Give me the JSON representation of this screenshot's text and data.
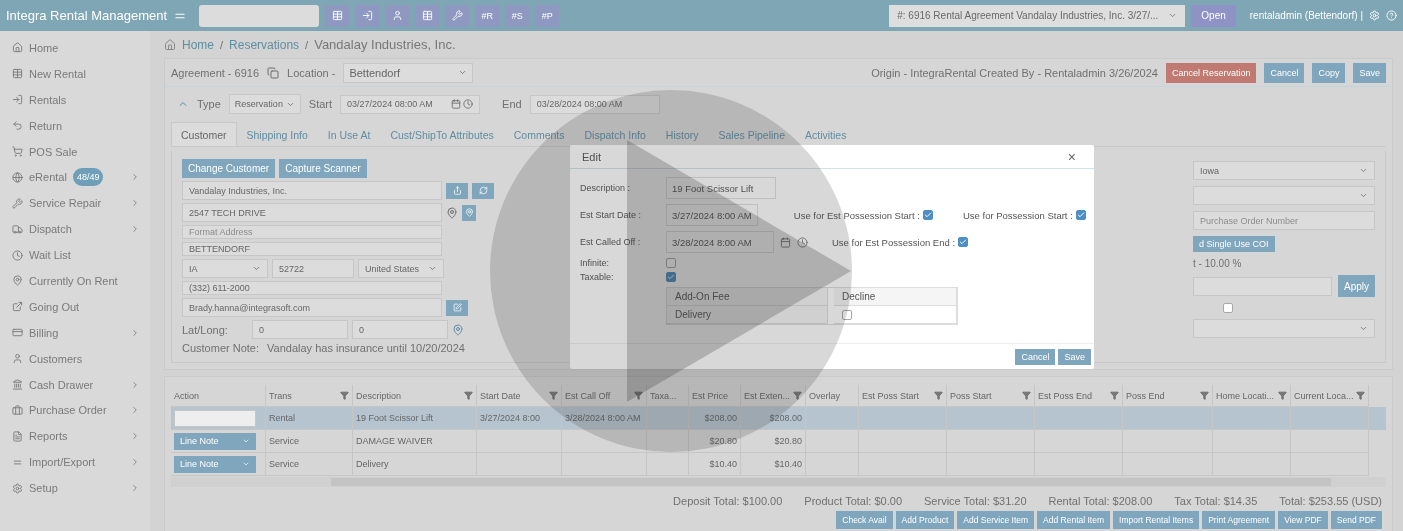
{
  "top_bar": {
    "brand": "Integra Rental Management",
    "shortcuts": [
      "#R",
      "#S",
      "#P"
    ],
    "agreement_select": "#: 6916 Rental Agreement Vandalay Industries, Inc. 3/27/...",
    "open_button": "Open",
    "user": "rentaladmin (Bettendorf) |"
  },
  "sidebar": {
    "items": [
      {
        "label": "Home",
        "expandable": false
      },
      {
        "label": "New Rental",
        "expandable": false
      },
      {
        "label": "Rentals",
        "expandable": false
      },
      {
        "label": "Return",
        "expandable": false
      },
      {
        "label": "POS Sale",
        "expandable": false
      },
      {
        "label": "eRental",
        "badge": "48/49",
        "expandable": true
      },
      {
        "label": "Service Repair",
        "expandable": true
      },
      {
        "label": "Dispatch",
        "expandable": true
      },
      {
        "label": "Wait List",
        "expandable": false
      },
      {
        "label": "Currently On Rent",
        "expandable": false
      },
      {
        "label": "Going Out",
        "expandable": false
      },
      {
        "label": "Billing",
        "expandable": true
      },
      {
        "label": "Customers",
        "expandable": false
      },
      {
        "label": "Cash Drawer",
        "expandable": true
      },
      {
        "label": "Purchase Order",
        "expandable": true
      },
      {
        "label": "Reports",
        "expandable": true
      },
      {
        "label": "Import/Export",
        "expandable": true
      },
      {
        "label": "Setup",
        "expandable": true
      }
    ]
  },
  "breadcrumb": [
    {
      "label": "Home",
      "kind": "link"
    },
    {
      "label": "/",
      "kind": "separator"
    },
    {
      "label": "Reservations",
      "kind": "link"
    },
    {
      "label": "/",
      "kind": "separator"
    },
    {
      "label": "Vandalay Industries, Inc.",
      "kind": "current"
    }
  ],
  "agreement": {
    "title": "Agreement - 6916",
    "location_label": "Location -",
    "location": "Bettendorf",
    "origin": "Origin - IntegraRental Created By - Rentaladmin 3/26/2024",
    "buttons": [
      {
        "label": "Cancel Reservation",
        "kind": "danger"
      },
      {
        "label": "Cancel",
        "kind": "primary"
      },
      {
        "label": "Copy",
        "kind": "primary"
      },
      {
        "label": "Save",
        "kind": "primary"
      }
    ]
  },
  "dates": {
    "type_label": "Type",
    "type": "Reservation",
    "start_label": "Start",
    "start": "03/27/2024 08:00 AM",
    "end_label": "End",
    "end": "03/28/2024 08:00 AM"
  },
  "tabs": [
    {
      "label": "Customer",
      "selected": true
    },
    {
      "label": "Shipping Info",
      "selected": false
    },
    {
      "label": "In Use At",
      "selected": false
    },
    {
      "label": "Cust/ShipTo Attributes",
      "selected": false
    },
    {
      "label": "Comments",
      "selected": false
    },
    {
      "label": "Dispatch Info",
      "selected": false
    },
    {
      "label": "History",
      "selected": false
    },
    {
      "label": "Sales Pipeline",
      "selected": false
    },
    {
      "label": "Activities",
      "selected": false
    }
  ],
  "customer": {
    "buttons": [
      "Change Customer",
      "Capture Scanner"
    ],
    "name": "Vandalay Industries, Inc.",
    "address": "2547 TECH DRIVE",
    "address2_placeholder": "Format Address",
    "city": "BETTENDORF",
    "state": "IA",
    "zip": "52722",
    "country": "United States",
    "phone": "(332) 611-2000",
    "email": "Brady.hanna@integrasoft.com",
    "latlong_label": "Lat/Long:",
    "lat": "0",
    "long": "0",
    "note_label": "Customer Note:",
    "note": "Vandalay has insurance until 10/20/2024"
  },
  "side_panel": {
    "state": "Iowa",
    "po_placeholder": "Purchase Order Number",
    "coi_button": "d Single Use COI",
    "discount": "t - 10.00 %",
    "apply_button": "Apply",
    "checked": false
  },
  "modal": {
    "title": "Edit",
    "close": "×",
    "description_label": "Description :",
    "description": "19 Foot Scissor Lift",
    "rows": [
      {
        "label": "Est Start Date :",
        "value": "3/27/2024 8:00 AM",
        "checks": [
          {
            "label": "Use for Est Possession Start :",
            "checked": true
          },
          {
            "label": "Use for Possession Start :",
            "checked": true
          }
        ]
      },
      {
        "label": "Est Called Off :",
        "value": "3/28/2024 8:00 AM",
        "checks": [
          {
            "label": "Use for Est Possession End :",
            "checked": true
          }
        ]
      }
    ],
    "flags": [
      {
        "label": "Infinite:",
        "checked": false
      },
      {
        "label": "Taxable:",
        "checked": true
      }
    ],
    "addon_table": {
      "columns": [
        "Add-On Fee",
        "Decline"
      ],
      "rows": [
        {
          "fee": "Delivery",
          "declined": false
        }
      ]
    },
    "buttons": [
      "Cancel",
      "Save"
    ]
  },
  "grid": {
    "columns": [
      {
        "label": "Action",
        "filter": false
      },
      {
        "label": "Trans",
        "filter": true
      },
      {
        "label": "Description",
        "filter": true
      },
      {
        "label": "Start Date",
        "filter": true
      },
      {
        "label": "Est Call Off",
        "filter": true
      },
      {
        "label": "Taxa...",
        "filter": false
      },
      {
        "label": "Est Price",
        "filter": false
      },
      {
        "label": "Est Exten...",
        "filter": true
      },
      {
        "label": "Overlay",
        "filter": false
      },
      {
        "label": "Est Poss Start",
        "filter": true
      },
      {
        "label": "Poss Start",
        "filter": true
      },
      {
        "label": "Est Poss End",
        "filter": true
      },
      {
        "label": "Poss End",
        "filter": true
      },
      {
        "label": "Home Locati...",
        "filter": true
      },
      {
        "label": "Current Loca...",
        "filter": true
      }
    ],
    "rows": [
      {
        "selected": true,
        "action": {
          "kind": "input"
        },
        "trans": "Rental",
        "description": "19 Foot Scissor Lift",
        "start_date": "3/27/2024 8:00",
        "est_call_off": "3/28/2024 8:00 AM",
        "est_price": "$208.00",
        "est_extended": "$208.00"
      },
      {
        "selected": false,
        "action": {
          "kind": "select",
          "value": "Line Note"
        },
        "trans": "Service",
        "description": "DAMAGE WAIVER",
        "est_price": "$20.80",
        "est_extended": "$20.80"
      },
      {
        "selected": false,
        "action": {
          "kind": "select",
          "value": "Line Note"
        },
        "trans": "Service",
        "description": "Delivery",
        "est_price": "$10.40",
        "est_extended": "$10.40"
      }
    ]
  },
  "totals": [
    "Deposit Total: $100.00",
    "Product Total: $0.00",
    "Service Total: $31.20",
    "Rental Total: $208.00",
    "Tax Total: $14.35",
    "Total: $253.55 (USD)"
  ],
  "actions": [
    "Check Avail",
    "Add Product",
    "Add Service Item",
    "Add Rental Item",
    "Import Rental Items",
    "Print Agreement",
    "View PDF",
    "Send PDF"
  ]
}
